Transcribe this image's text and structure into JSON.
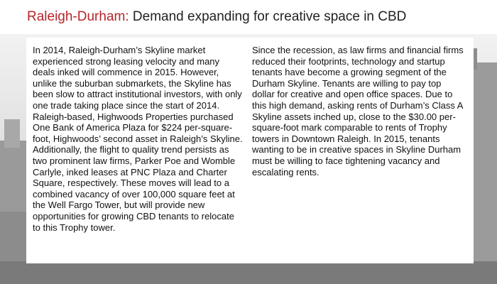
{
  "slide": {
    "title_city": "Raleigh-Durham:",
    "title_rest": " Demand expanding for creative space in CBD",
    "accent_color": "#b5252b",
    "background_image": "grayscale-city-skyline",
    "left_paragraph": "In 2014, Raleigh-Durham’s Skyline market experienced strong leasing velocity and many deals inked will commence in 2015. However, unlike the suburban submarkets, the Skyline has been slow to attract institutional investors, with only one trade taking place since the start of 2014. Raleigh-based, Highwoods Properties purchased One Bank of America Plaza for $224 per-square-foot, Highwoods’ second asset in Raleigh’s Skyline. Additionally, the flight to quality trend persists as two prominent law firms, Parker Poe and Womble Carlyle, inked leases at PNC Plaza and Charter Square, respectively. These moves will lead to a combined vacancy of over 100,000 square feet at the Well Fargo Tower, but will provide new opportunities for growing CBD tenants to relocate to this Trophy tower.",
    "right_paragraph": "Since the recession, as law firms and financial firms reduced their footprints, technology and startup tenants have become a growing segment of the Durham Skyline. Tenants are willing to pay top dollar for creative and open office spaces. Due to this high demand, asking rents of Durham’s Class A Skyline assets inched up, close to the $30.00 per-square-foot mark comparable to rents of Trophy towers in Downtown Raleigh. In 2015, tenants wanting to be in creative spaces in Skyline Durham must be willing to face tightening vacancy and escalating rents."
  }
}
